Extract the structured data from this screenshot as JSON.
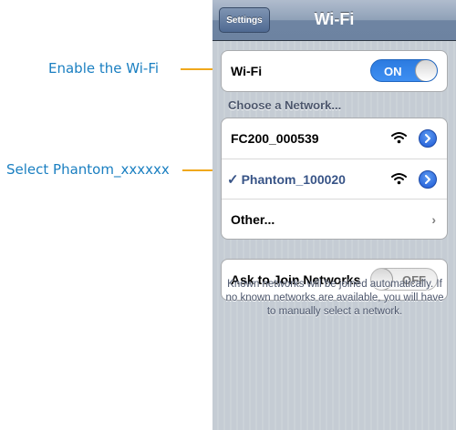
{
  "annotations": {
    "enable_wifi": "Enable the Wi-Fi",
    "select_phantom": "Select Phantom_xxxxxx"
  },
  "navbar": {
    "back_label": "Settings",
    "title": "Wi-Fi"
  },
  "wifi_row": {
    "label": "Wi-Fi",
    "toggle_state": "ON"
  },
  "networks": {
    "header": "Choose a Network...",
    "items": [
      {
        "name": "FC200_000539",
        "selected": false
      },
      {
        "name": "Phantom_100020",
        "selected": true
      },
      {
        "name": "Other...",
        "selected": false
      }
    ]
  },
  "ask_to_join": {
    "label": "Ask to Join Networks",
    "toggle_state": "OFF",
    "note": "Known networks will be joined automatically. If no known networks are available, you will have to manually select a network."
  },
  "icons": {
    "checkmark": "✓",
    "chevron": "›",
    "wifi": "wifi-icon",
    "detail": "detail-disclosure-icon"
  },
  "colors": {
    "accent_blue": "#2c7be0",
    "selected_text": "#385487",
    "callout_text": "#1a7fc1",
    "callout_line": "#f0a81c"
  }
}
